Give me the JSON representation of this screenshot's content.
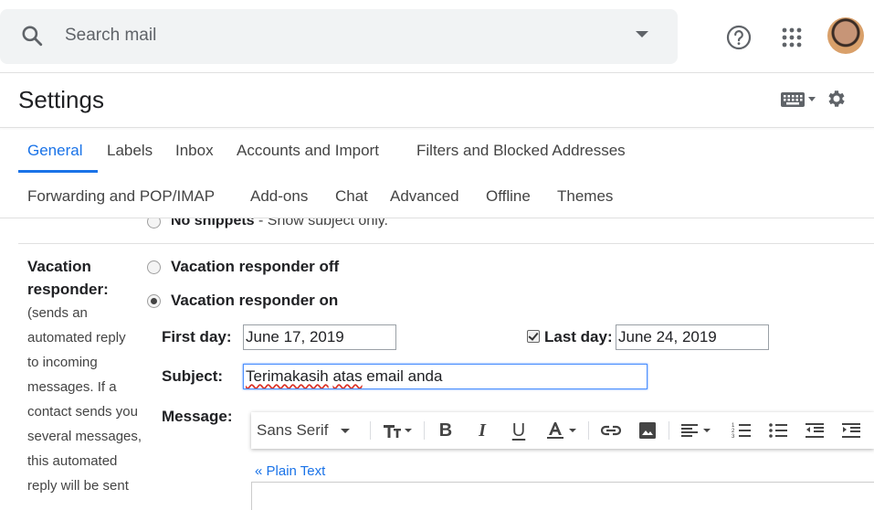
{
  "search": {
    "placeholder": "Search mail"
  },
  "header": {
    "title": "Settings"
  },
  "tabs_row1": [
    "General",
    "Labels",
    "Inbox",
    "Accounts and Import",
    "Filters and Blocked Addresses"
  ],
  "tabs_row2": [
    "Forwarding and POP/IMAP",
    "Add-ons",
    "Chat",
    "Advanced",
    "Offline",
    "Themes"
  ],
  "snippets": {
    "option_bold": "No snippets",
    "option_rest": " - Show subject only."
  },
  "vacation": {
    "label_line1": "Vacation",
    "label_line2": "responder:",
    "description": [
      "(sends an",
      "automated reply",
      "to incoming",
      "messages. If a",
      "contact sends you",
      "several messages,",
      "this automated",
      "reply will be sent"
    ],
    "off_label": "Vacation responder off",
    "on_label": "Vacation responder on",
    "first_day_label": "First day:",
    "first_day_value": "June 17, 2019",
    "last_day_label": "Last day:",
    "last_day_value": "June 24, 2019",
    "subject_label": "Subject:",
    "subject_word1": "Terimakasih",
    "subject_word2": "atas",
    "subject_rest": " email anda",
    "message_label": "Message:",
    "font_name": "Sans Serif",
    "plain_text_link": "« Plain Text"
  }
}
